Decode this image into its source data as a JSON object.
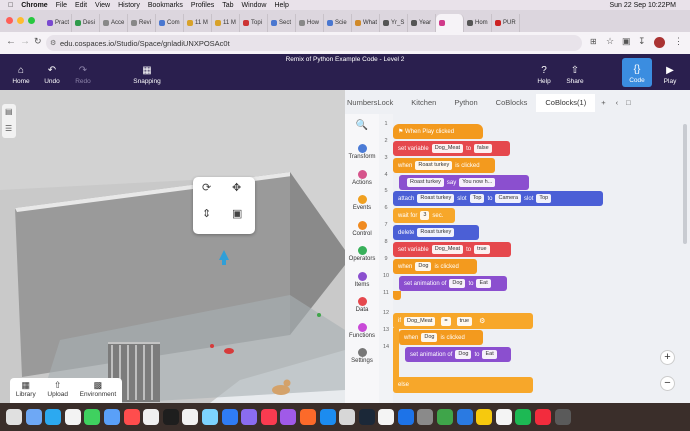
{
  "menubar": {
    "app": "Chrome",
    "items": [
      "File",
      "Edit",
      "View",
      "History",
      "Bookmarks",
      "Profiles",
      "Tab",
      "Window",
      "Help"
    ],
    "clock": "Sun 22 Sep 10:22PM"
  },
  "tabs": [
    {
      "label": "Pract",
      "color": "#7a4ad0"
    },
    {
      "label": "Desi",
      "color": "#2e9a4a"
    },
    {
      "label": "Acce",
      "color": "#888888"
    },
    {
      "label": "Revi",
      "color": "#888888"
    },
    {
      "label": "Com",
      "color": "#4a77d0"
    },
    {
      "label": "11 M",
      "color": "#d8a22a"
    },
    {
      "label": "11 M",
      "color": "#d8a22a"
    },
    {
      "label": "Topi",
      "color": "#cc3333"
    },
    {
      "label": "Sect",
      "color": "#4a77d0"
    },
    {
      "label": "How",
      "color": "#888888"
    },
    {
      "label": "Scie",
      "color": "#4a77d0"
    },
    {
      "label": "What",
      "color": "#d08a2a"
    },
    {
      "label": "Yr_S",
      "color": "#555555"
    },
    {
      "label": "Year",
      "color": "#555555"
    },
    {
      "label": "",
      "color": "#d03a8a"
    },
    {
      "label": "Hom",
      "color": "#555555"
    },
    {
      "label": "PUR",
      "color": "#cc2222"
    }
  ],
  "address": {
    "url": "edu.cospaces.io/Studio/Space/gnladiUNXPOSAc0t"
  },
  "header": {
    "title": "Remix of Python Example Code - Level 2",
    "home": "Home",
    "undo": "Undo",
    "redo": "Redo",
    "snapping": "Snapping",
    "help": "Help",
    "share": "Share",
    "code": "Code",
    "play": "Play"
  },
  "scene": {
    "library": "Library",
    "upload": "Upload",
    "environment": "Environment"
  },
  "codetabs": [
    "NumbersLock",
    "Kitchen",
    "Python",
    "CoBlocks",
    "CoBlocks(1)"
  ],
  "categories": [
    {
      "label": "Transform",
      "color": "#4b7bd6"
    },
    {
      "label": "Actions",
      "color": "#d6548c"
    },
    {
      "label": "Events",
      "color": "#f0a020"
    },
    {
      "label": "Control",
      "color": "#f08a20"
    },
    {
      "label": "Operators",
      "color": "#38b05a"
    },
    {
      "label": "Items",
      "color": "#8b4fcf"
    },
    {
      "label": "Data",
      "color": "#e5484d"
    },
    {
      "label": "Functions",
      "color": "#c94ad8"
    },
    {
      "label": "Settings",
      "color": "#777777"
    }
  ],
  "lines": [
    "1",
    "2",
    "3",
    "4",
    "5",
    "6",
    "7",
    "8",
    "9",
    "10",
    "11",
    "12",
    "13",
    "14"
  ],
  "blocks": {
    "b1": {
      "t": "When Play clicked"
    },
    "b2": {
      "a": "set variable",
      "v": "Dog_Meat",
      "b": "to",
      "c": "false"
    },
    "b3": {
      "a": "when",
      "v": "Roast turkey",
      "b": "is clicked"
    },
    "b4": {
      "v": "Roast turkey",
      "a": "say",
      "b": "You now h..."
    },
    "b5": {
      "a": "attach",
      "v": "Roast turkey",
      "b": "slot",
      "c": "Top",
      "d": "to",
      "e": "Camera",
      "f": "slot",
      "g": "Top"
    },
    "b6": {
      "a": "wait for",
      "v": "3",
      "b": "sec."
    },
    "b7": {
      "a": "delete",
      "v": "Roast turkey"
    },
    "b8": {
      "a": "set variable",
      "v": "Dog_Meat",
      "b": "to",
      "c": "true"
    },
    "b9": {
      "a": "when",
      "v": "Dog",
      "b": "is clicked"
    },
    "b10": {
      "a": "set animation of",
      "v": "Dog",
      "b": "to",
      "c": "Eat"
    },
    "b12": {
      "a": "if",
      "v": "Dog_Meat",
      "b": "=",
      "c": "true"
    },
    "b13": {
      "a": "when",
      "v": "Dog",
      "b": "is clicked"
    },
    "b14": {
      "a": "set animation of",
      "v": "Dog",
      "b": "to",
      "c": "Eat"
    },
    "b15": {
      "t": "else"
    }
  }
}
